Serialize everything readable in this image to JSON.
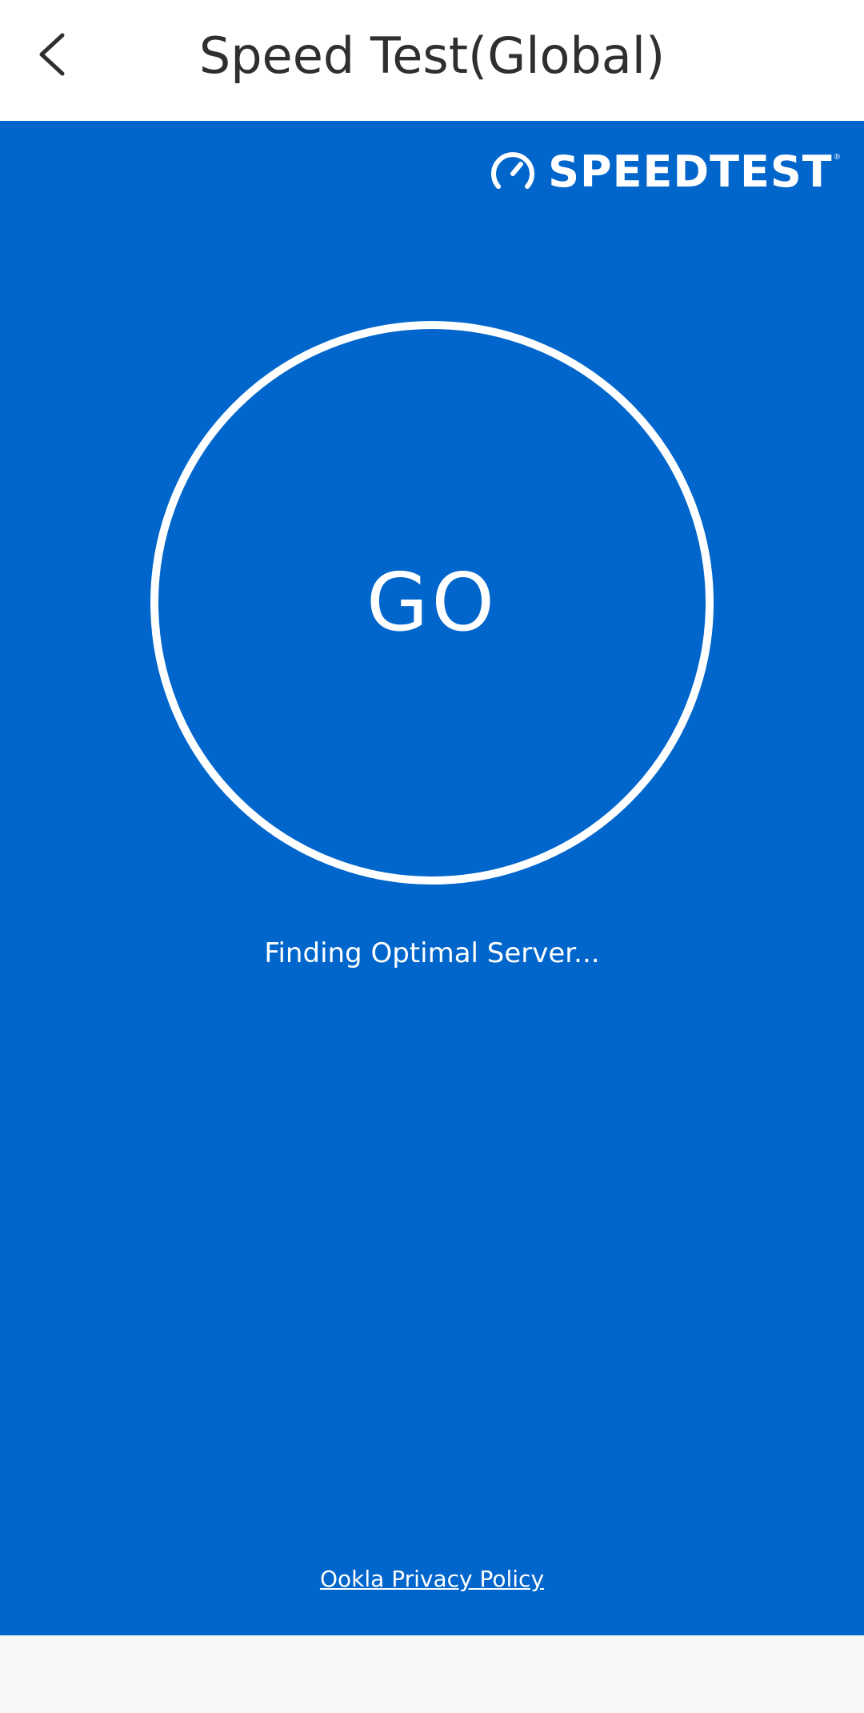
{
  "header": {
    "title": "Speed Test(Global)",
    "back_icon": "chevron-left-icon"
  },
  "brand": {
    "name": "SPEEDTEST",
    "registered_mark": "®",
    "icon": "speedometer-icon"
  },
  "main": {
    "go_label": "GO",
    "status": "Finding Optimal Server...",
    "privacy_link": "Ookla Privacy Policy"
  },
  "colors": {
    "header_bg": "#ffffff",
    "main_bg": "#0066cc",
    "foreground": "#ffffff",
    "title_text": "#2f2f2f",
    "bottom_bar": "#f7f7f7"
  }
}
